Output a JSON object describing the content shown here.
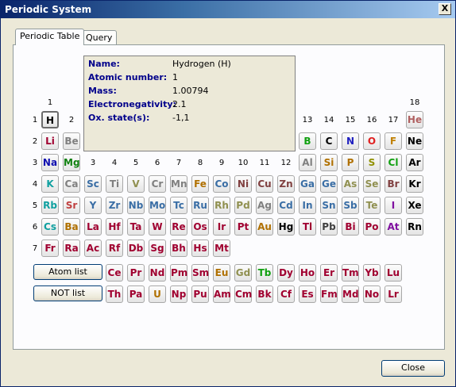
{
  "window": {
    "title": "Periodic System",
    "close_glyph": "X"
  },
  "tabs": [
    "Periodic Table",
    "Query"
  ],
  "info": {
    "rows": [
      {
        "label": "Name:",
        "value": "Hydrogen (H)"
      },
      {
        "label": "Atomic number:",
        "value": "1"
      },
      {
        "label": "Mass:",
        "value": "1.00794"
      },
      {
        "label": "Electronegativity:",
        "value": "2.1"
      },
      {
        "label": "Ox. state(s):",
        "value": "-1,1"
      }
    ]
  },
  "groups": [
    "1",
    "2",
    "3",
    "4",
    "5",
    "6",
    "7",
    "8",
    "9",
    "10",
    "11",
    "12",
    "13",
    "14",
    "15",
    "16",
    "17",
    "18"
  ],
  "periods": [
    "1",
    "2",
    "3",
    "4",
    "5",
    "6",
    "7"
  ],
  "elements": [
    {
      "s": "H",
      "c": "#000000",
      "p": 1,
      "g": 1,
      "selected": true
    },
    {
      "s": "He",
      "c": "#b06060",
      "p": 1,
      "g": 18
    },
    {
      "s": "Li",
      "c": "#a00030",
      "p": 2,
      "g": 1
    },
    {
      "s": "Be",
      "c": "#808080",
      "p": 2,
      "g": 2
    },
    {
      "s": "B",
      "c": "#10a010",
      "p": 2,
      "g": 13
    },
    {
      "s": "C",
      "c": "#000000",
      "p": 2,
      "g": 14
    },
    {
      "s": "N",
      "c": "#2020c0",
      "p": 2,
      "g": 15
    },
    {
      "s": "O",
      "c": "#e02020",
      "p": 2,
      "g": 16
    },
    {
      "s": "F",
      "c": "#c08000",
      "p": 2,
      "g": 17
    },
    {
      "s": "Ne",
      "c": "#000000",
      "p": 2,
      "g": 18
    },
    {
      "s": "Na",
      "c": "#1010b0",
      "p": 3,
      "g": 1
    },
    {
      "s": "Mg",
      "c": "#108010",
      "p": 3,
      "g": 2
    },
    {
      "s": "Al",
      "c": "#808080",
      "p": 3,
      "g": 13
    },
    {
      "s": "Si",
      "c": "#b07000",
      "p": 3,
      "g": 14
    },
    {
      "s": "P",
      "c": "#b07000",
      "p": 3,
      "g": 15
    },
    {
      "s": "S",
      "c": "#909000",
      "p": 3,
      "g": 16
    },
    {
      "s": "Cl",
      "c": "#10a010",
      "p": 3,
      "g": 17
    },
    {
      "s": "Ar",
      "c": "#000000",
      "p": 3,
      "g": 18
    },
    {
      "s": "K",
      "c": "#10a0a0",
      "p": 4,
      "g": 1
    },
    {
      "s": "Ca",
      "c": "#808080",
      "p": 4,
      "g": 2
    },
    {
      "s": "Sc",
      "c": "#3a6ea5",
      "p": 4,
      "g": 3
    },
    {
      "s": "Ti",
      "c": "#808080",
      "p": 4,
      "g": 4
    },
    {
      "s": "V",
      "c": "#909050",
      "p": 4,
      "g": 5
    },
    {
      "s": "Cr",
      "c": "#808080",
      "p": 4,
      "g": 6
    },
    {
      "s": "Mn",
      "c": "#808080",
      "p": 4,
      "g": 7
    },
    {
      "s": "Fe",
      "c": "#b07000",
      "p": 4,
      "g": 8
    },
    {
      "s": "Co",
      "c": "#3a6ea5",
      "p": 4,
      "g": 9
    },
    {
      "s": "Ni",
      "c": "#804040",
      "p": 4,
      "g": 10
    },
    {
      "s": "Cu",
      "c": "#804040",
      "p": 4,
      "g": 11
    },
    {
      "s": "Zn",
      "c": "#804040",
      "p": 4,
      "g": 12
    },
    {
      "s": "Ga",
      "c": "#3a6ea5",
      "p": 4,
      "g": 13
    },
    {
      "s": "Ge",
      "c": "#3a6ea5",
      "p": 4,
      "g": 14
    },
    {
      "s": "As",
      "c": "#909050",
      "p": 4,
      "g": 15
    },
    {
      "s": "Se",
      "c": "#909050",
      "p": 4,
      "g": 16
    },
    {
      "s": "Br",
      "c": "#804040",
      "p": 4,
      "g": 17
    },
    {
      "s": "Kr",
      "c": "#000000",
      "p": 4,
      "g": 18
    },
    {
      "s": "Rb",
      "c": "#10a0a0",
      "p": 5,
      "g": 1
    },
    {
      "s": "Sr",
      "c": "#c04040",
      "p": 5,
      "g": 2
    },
    {
      "s": "Y",
      "c": "#3a6ea5",
      "p": 5,
      "g": 3
    },
    {
      "s": "Zr",
      "c": "#3a6ea5",
      "p": 5,
      "g": 4
    },
    {
      "s": "Nb",
      "c": "#3a6ea5",
      "p": 5,
      "g": 5
    },
    {
      "s": "Mo",
      "c": "#3a6ea5",
      "p": 5,
      "g": 6
    },
    {
      "s": "Tc",
      "c": "#3a6ea5",
      "p": 5,
      "g": 7
    },
    {
      "s": "Ru",
      "c": "#3a6ea5",
      "p": 5,
      "g": 8
    },
    {
      "s": "Rh",
      "c": "#909050",
      "p": 5,
      "g": 9
    },
    {
      "s": "Pd",
      "c": "#909050",
      "p": 5,
      "g": 10
    },
    {
      "s": "Ag",
      "c": "#808080",
      "p": 5,
      "g": 11
    },
    {
      "s": "Cd",
      "c": "#3a6ea5",
      "p": 5,
      "g": 12
    },
    {
      "s": "In",
      "c": "#3a6ea5",
      "p": 5,
      "g": 13
    },
    {
      "s": "Sn",
      "c": "#3a6ea5",
      "p": 5,
      "g": 14
    },
    {
      "s": "Sb",
      "c": "#3a6ea5",
      "p": 5,
      "g": 15
    },
    {
      "s": "Te",
      "c": "#909050",
      "p": 5,
      "g": 16
    },
    {
      "s": "I",
      "c": "#8010a0",
      "p": 5,
      "g": 17
    },
    {
      "s": "Xe",
      "c": "#000000",
      "p": 5,
      "g": 18
    },
    {
      "s": "Cs",
      "c": "#10a0a0",
      "p": 6,
      "g": 1
    },
    {
      "s": "Ba",
      "c": "#b07000",
      "p": 6,
      "g": 2
    },
    {
      "s": "La",
      "c": "#a00030",
      "p": 6,
      "g": 3
    },
    {
      "s": "Hf",
      "c": "#a00030",
      "p": 6,
      "g": 4
    },
    {
      "s": "Ta",
      "c": "#a00030",
      "p": 6,
      "g": 5
    },
    {
      "s": "W",
      "c": "#a00030",
      "p": 6,
      "g": 6
    },
    {
      "s": "Re",
      "c": "#a00030",
      "p": 6,
      "g": 7
    },
    {
      "s": "Os",
      "c": "#a00030",
      "p": 6,
      "g": 8
    },
    {
      "s": "Ir",
      "c": "#a00030",
      "p": 6,
      "g": 9
    },
    {
      "s": "Pt",
      "c": "#a00030",
      "p": 6,
      "g": 10
    },
    {
      "s": "Au",
      "c": "#b07000",
      "p": 6,
      "g": 11
    },
    {
      "s": "Hg",
      "c": "#000000",
      "p": 6,
      "g": 12
    },
    {
      "s": "Tl",
      "c": "#a00030",
      "p": 6,
      "g": 13
    },
    {
      "s": "Pb",
      "c": "#404040",
      "p": 6,
      "g": 14
    },
    {
      "s": "Bi",
      "c": "#a00030",
      "p": 6,
      "g": 15
    },
    {
      "s": "Po",
      "c": "#a00030",
      "p": 6,
      "g": 16
    },
    {
      "s": "At",
      "c": "#8010a0",
      "p": 6,
      "g": 17
    },
    {
      "s": "Rn",
      "c": "#000000",
      "p": 6,
      "g": 18
    },
    {
      "s": "Fr",
      "c": "#a00030",
      "p": 7,
      "g": 1
    },
    {
      "s": "Ra",
      "c": "#a00030",
      "p": 7,
      "g": 2
    },
    {
      "s": "Ac",
      "c": "#a00030",
      "p": 7,
      "g": 3
    },
    {
      "s": "Rf",
      "c": "#a00030",
      "p": 7,
      "g": 4
    },
    {
      "s": "Db",
      "c": "#a00030",
      "p": 7,
      "g": 5
    },
    {
      "s": "Sg",
      "c": "#a00030",
      "p": 7,
      "g": 6
    },
    {
      "s": "Bh",
      "c": "#a00030",
      "p": 7,
      "g": 7
    },
    {
      "s": "Hs",
      "c": "#a00030",
      "p": 7,
      "g": 8
    },
    {
      "s": "Mt",
      "c": "#a00030",
      "p": 7,
      "g": 9
    }
  ],
  "lanthanides": [
    {
      "s": "Ce",
      "c": "#a00030"
    },
    {
      "s": "Pr",
      "c": "#a00030"
    },
    {
      "s": "Nd",
      "c": "#a00030"
    },
    {
      "s": "Pm",
      "c": "#a00030"
    },
    {
      "s": "Sm",
      "c": "#a00030"
    },
    {
      "s": "Eu",
      "c": "#b07000"
    },
    {
      "s": "Gd",
      "c": "#909050"
    },
    {
      "s": "Tb",
      "c": "#10a010"
    },
    {
      "s": "Dy",
      "c": "#a00030"
    },
    {
      "s": "Ho",
      "c": "#a00030"
    },
    {
      "s": "Er",
      "c": "#a00030"
    },
    {
      "s": "Tm",
      "c": "#a00030"
    },
    {
      "s": "Yb",
      "c": "#a00030"
    },
    {
      "s": "Lu",
      "c": "#a00030"
    }
  ],
  "actinides": [
    {
      "s": "Th",
      "c": "#a00030"
    },
    {
      "s": "Pa",
      "c": "#a00030"
    },
    {
      "s": "U",
      "c": "#b07000"
    },
    {
      "s": "Np",
      "c": "#a00030"
    },
    {
      "s": "Pu",
      "c": "#a00030"
    },
    {
      "s": "Am",
      "c": "#a00030"
    },
    {
      "s": "Cm",
      "c": "#a00030"
    },
    {
      "s": "Bk",
      "c": "#a00030"
    },
    {
      "s": "Cf",
      "c": "#a00030"
    },
    {
      "s": "Es",
      "c": "#a00030"
    },
    {
      "s": "Fm",
      "c": "#a00030"
    },
    {
      "s": "Md",
      "c": "#a00030"
    },
    {
      "s": "No",
      "c": "#a00030"
    },
    {
      "s": "Lr",
      "c": "#a00030"
    }
  ],
  "buttons": {
    "atom_list": "Atom list",
    "not_list": "NOT list",
    "close": "Close"
  }
}
